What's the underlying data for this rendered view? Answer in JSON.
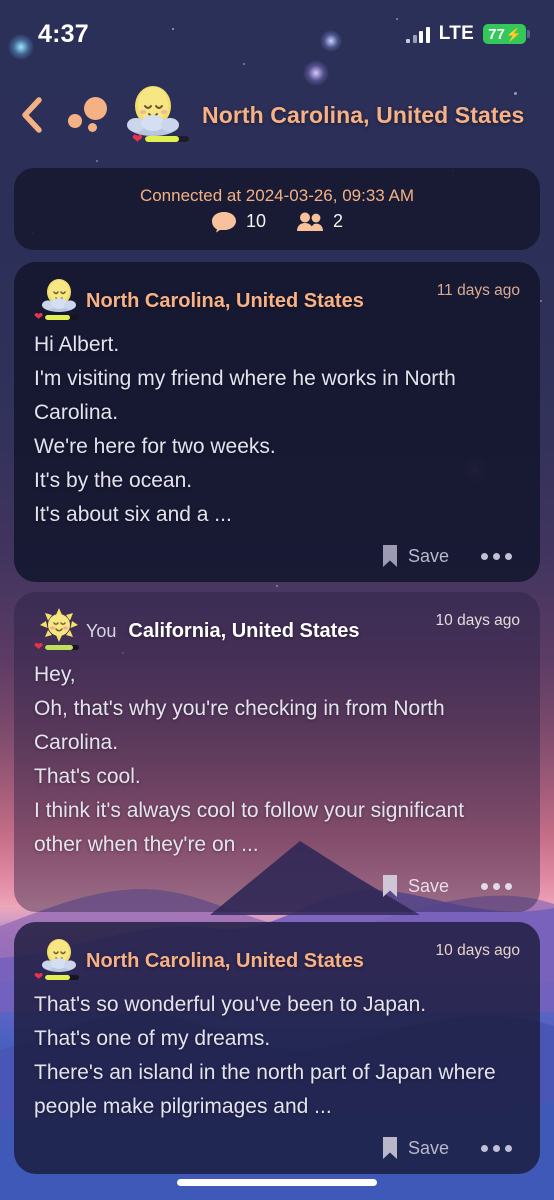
{
  "status_bar": {
    "time": "4:37",
    "network": "LTE",
    "battery_percent": "77",
    "charging_icon": "⚡",
    "signal_icon": "signal-bars-icon"
  },
  "header": {
    "back_icon": "chevron-left-icon",
    "bubbles_icon": "bubbles-icon",
    "avatar_icon": "egg-on-cloud-avatar",
    "title": "North Carolina, United States",
    "health_percent": 78
  },
  "connection": {
    "label": "Connected at 2024-03-26, 09:33 AM",
    "messages_icon": "chat-bubble-icon",
    "messages_count": "10",
    "people_icon": "people-icon",
    "people_count": "2"
  },
  "colors": {
    "accent_orange": "#f7b184",
    "timestamp": "#d9ab92",
    "body_text": "#e3e3ee",
    "battery_green": "#34c759",
    "card_dark": "#161830"
  },
  "footer_actions": {
    "save_icon": "bookmark-icon",
    "save_label": "Save",
    "more_icon": "ellipsis-icon"
  },
  "messages": [
    {
      "avatar_icon": "egg-on-cloud-avatar",
      "is_you": false,
      "you_label": "",
      "sender": "North Carolina, United States",
      "timestamp": "11 days ago",
      "lines": [
        "Hi Albert.",
        "I'm visiting my friend where he works in North",
        "Carolina.",
        "We're here for two weeks.",
        "It's by the ocean.",
        "It's about six and a ..."
      ]
    },
    {
      "avatar_icon": "sun-avatar",
      "is_you": true,
      "you_label": "You",
      "sender": "California, United States",
      "timestamp": "10 days ago",
      "lines": [
        "Hey,",
        "Oh, that's why you're checking in from North",
        "Carolina.",
        "That's cool.",
        "I think it's always cool to follow your significant",
        "other when they're on ..."
      ]
    },
    {
      "avatar_icon": "egg-on-cloud-avatar",
      "is_you": false,
      "you_label": "",
      "sender": "North Carolina, United States",
      "timestamp": "10 days ago",
      "lines": [
        "That's so wonderful you've been to Japan.",
        "That's one of my dreams.",
        "There's an island in the north part of Japan where",
        "people make pilgrimages and ..."
      ]
    }
  ]
}
